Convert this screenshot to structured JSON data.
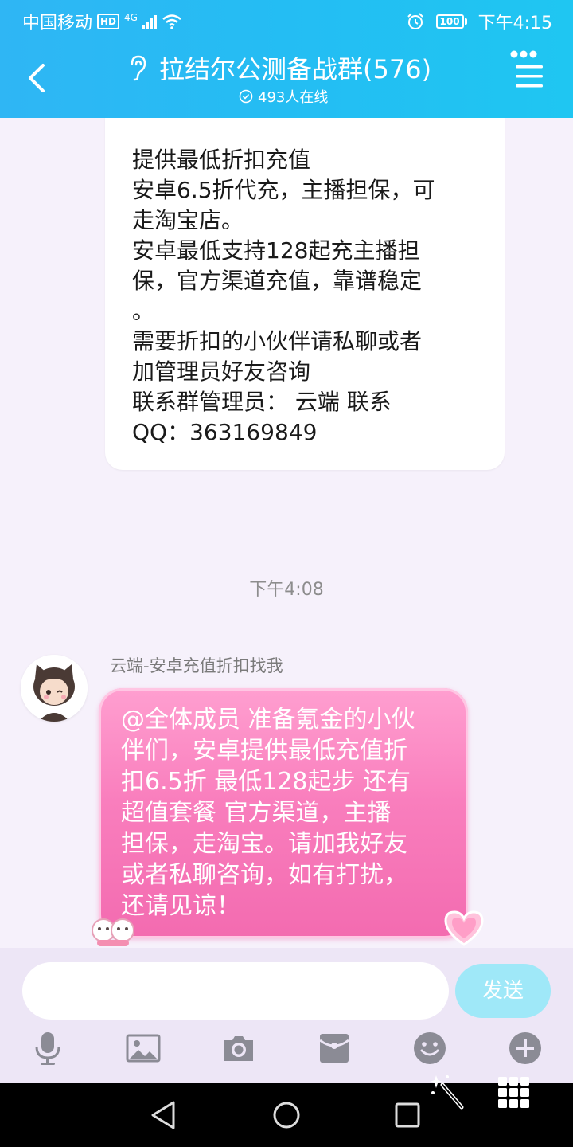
{
  "status_bar": {
    "carrier": "中国移动",
    "hd": "HD",
    "network": "4G",
    "battery": "100",
    "time": "下午4:15"
  },
  "header": {
    "title": "拉结尔公测备战群(576)",
    "online": "493人在线",
    "icons": [
      "back-arrow-icon",
      "earpiece-icon",
      "more-menu-icon"
    ]
  },
  "messages": {
    "card_lines": [
      "提供最低折扣充值",
      "安卓6.5折代充，主播担保，可",
      "走淘宝店。",
      "安卓最低支持128起充主播担",
      "保，官方渠道充值，靠谱稳定",
      "。",
      "需要折扣的小伙伴请私聊或者",
      "加管理员好友咨询",
      "联系群管理员：  云端  联系",
      "QQ：363169849"
    ],
    "timestamp": "下午4:08",
    "sender_name": "云端-安卓充值折扣找我",
    "bubble_lines": [
      "@全体成员 准备氪金的小伙",
      "伴们，安卓提供最低充值折",
      "扣6.5折 最低128起步 还有",
      "超值套餐  官方渠道，主播",
      "担保，走淘宝。请加我好友",
      "或者私聊咨询，如有打扰，",
      "还请见谅！"
    ]
  },
  "input_bar": {
    "value": "",
    "send_label": "发送",
    "tools": [
      "microphone-icon",
      "image-icon",
      "camera-icon",
      "red-packet-icon",
      "emoji-icon",
      "plus-icon"
    ]
  },
  "colors": {
    "header": "#24bdf3",
    "bubble": "#f97ebd",
    "send_button": "#9fe8f8",
    "tool_icon": "#8b8b95"
  }
}
